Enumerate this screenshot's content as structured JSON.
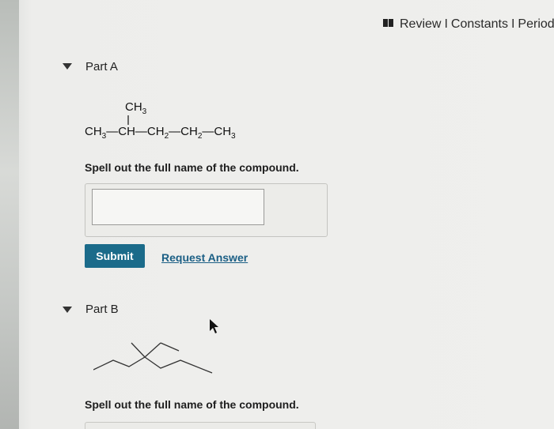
{
  "header": {
    "icon": "book-icon",
    "links": [
      "Review",
      "Constants",
      "Periodic"
    ],
    "separator": "I"
  },
  "part_a": {
    "label": "Part A",
    "formula": {
      "branch": "CH3",
      "main": [
        "CH3",
        "CH",
        "CH2",
        "CH2",
        "CH3"
      ]
    },
    "prompt": "Spell out the full name of the compound.",
    "answer_value": "",
    "submit_label": "Submit",
    "request_label": "Request Answer"
  },
  "part_b": {
    "label": "Part B",
    "prompt": "Spell out the full name of the compound."
  },
  "colors": {
    "submit_bg": "#1b6b8a",
    "link": "#1b5f85"
  }
}
